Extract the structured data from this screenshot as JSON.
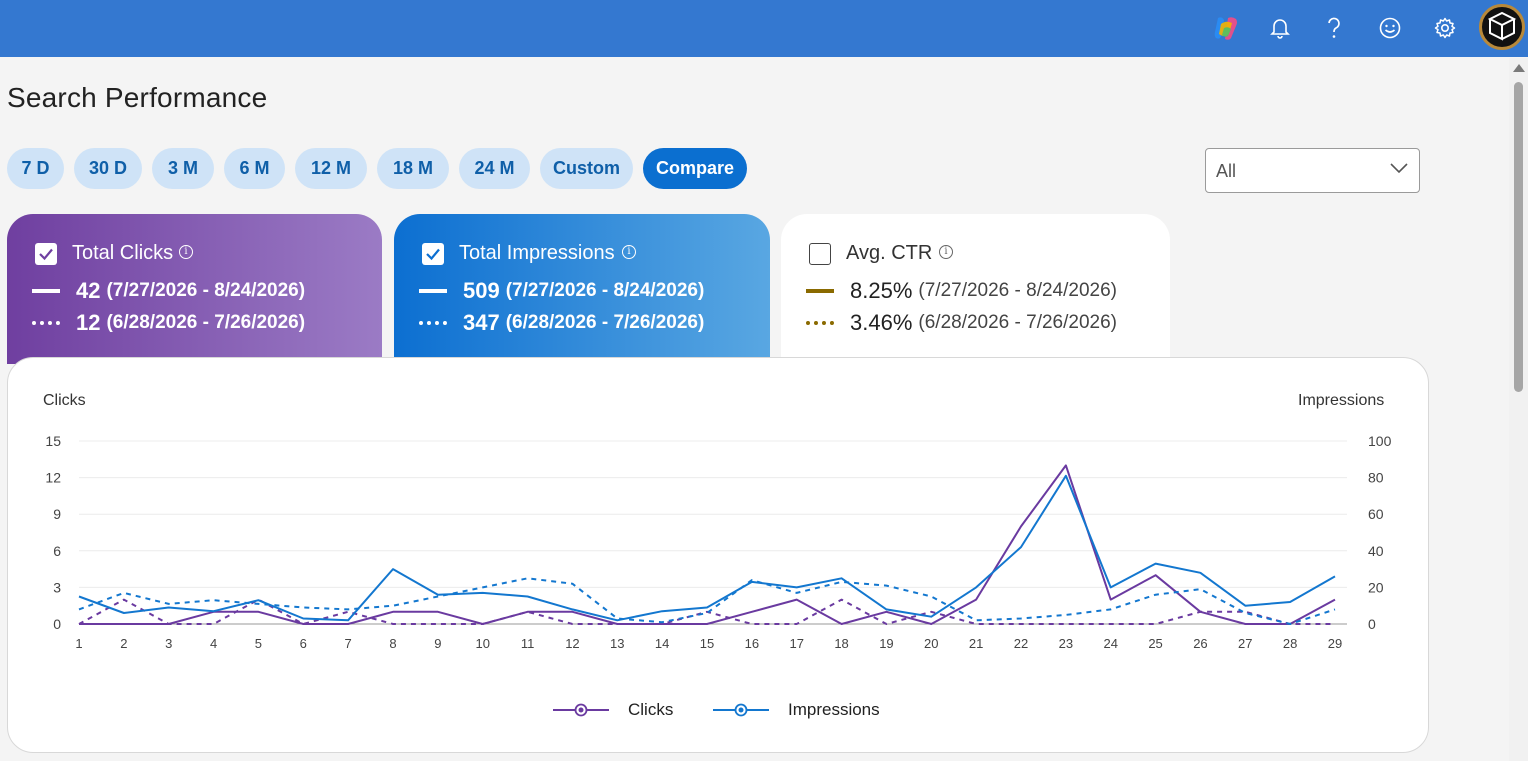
{
  "header": {
    "icons": [
      "copilot-icon",
      "bell-icon",
      "help-icon",
      "smiley-icon",
      "gear-icon",
      "avatar"
    ],
    "colors": {
      "bar": "#3478d0"
    }
  },
  "page": {
    "title": "Search Performance",
    "ranges": [
      "7 D",
      "30 D",
      "3 M",
      "6 M",
      "12 M",
      "18 M",
      "24 M",
      "Custom",
      "Compare"
    ],
    "active_range": "Compare",
    "filter": {
      "value": "All"
    }
  },
  "cards": {
    "clicks": {
      "title": "Total Clicks",
      "checked": true,
      "current": "42",
      "current_range": "(7/27/2026 - 8/24/2026)",
      "previous": "12",
      "previous_range": "(6/28/2026 - 7/26/2026)"
    },
    "impressions": {
      "title": "Total Impressions",
      "checked": true,
      "current": "509",
      "current_range": "(7/27/2026 - 8/24/2026)",
      "previous": "347",
      "previous_range": "(6/28/2026 - 7/26/2026)"
    },
    "ctr": {
      "title": "Avg. CTR",
      "checked": false,
      "current": "8.25%",
      "current_range": "(7/27/2026 - 8/24/2026)",
      "previous": "3.46%",
      "previous_range": "(6/28/2026 - 7/26/2026)"
    }
  },
  "chart_data": {
    "type": "line",
    "x": [
      1,
      2,
      3,
      4,
      5,
      6,
      7,
      8,
      9,
      10,
      11,
      12,
      13,
      14,
      15,
      16,
      17,
      18,
      19,
      20,
      21,
      22,
      23,
      24,
      25,
      26,
      27,
      28,
      29
    ],
    "left_axis": {
      "label": "Clicks",
      "ticks": [
        0,
        3,
        6,
        9,
        12,
        15
      ],
      "range": [
        0,
        15
      ]
    },
    "right_axis": {
      "label": "Impressions",
      "ticks": [
        0,
        20,
        40,
        60,
        80,
        100
      ],
      "range": [
        0,
        100
      ]
    },
    "series": [
      {
        "name": "Clicks",
        "axis": "left",
        "style": "solid",
        "color": "#6a3aa0",
        "values": [
          0,
          0,
          0,
          1,
          1,
          0,
          0,
          1,
          1,
          0,
          1,
          1,
          0,
          0,
          0,
          1,
          2,
          0,
          1,
          0,
          2,
          8,
          13,
          2,
          4,
          1,
          0,
          0,
          2
        ]
      },
      {
        "name": "Clicks",
        "axis": "left",
        "style": "dashed",
        "color": "#6a3aa0",
        "values": [
          0,
          2,
          0,
          0,
          2,
          0,
          1,
          0,
          0,
          0,
          1,
          0,
          0,
          0,
          1,
          0,
          0,
          2,
          0,
          1,
          0,
          0,
          0,
          0,
          0,
          1,
          1,
          0,
          0
        ]
      },
      {
        "name": "Impressions",
        "axis": "right",
        "style": "solid",
        "color": "#1377cf",
        "values": [
          15,
          6,
          9,
          7,
          13,
          3,
          2,
          30,
          16,
          17,
          15,
          8,
          2,
          7,
          9,
          23,
          20,
          25,
          8,
          4,
          20,
          42,
          81,
          20,
          33,
          28,
          10,
          12,
          26
        ]
      },
      {
        "name": "Impressions",
        "axis": "right",
        "style": "dashed",
        "color": "#1377cf",
        "values": [
          8,
          17,
          11,
          13,
          11,
          9,
          8,
          10,
          15,
          20,
          25,
          22,
          3,
          1,
          6,
          24,
          17,
          23,
          21,
          15,
          2,
          3,
          5,
          8,
          16,
          19,
          6,
          0,
          8
        ]
      }
    ],
    "legend": [
      "Clicks",
      "Impressions"
    ],
    "legend_position": "bottom-center",
    "grid": true
  }
}
